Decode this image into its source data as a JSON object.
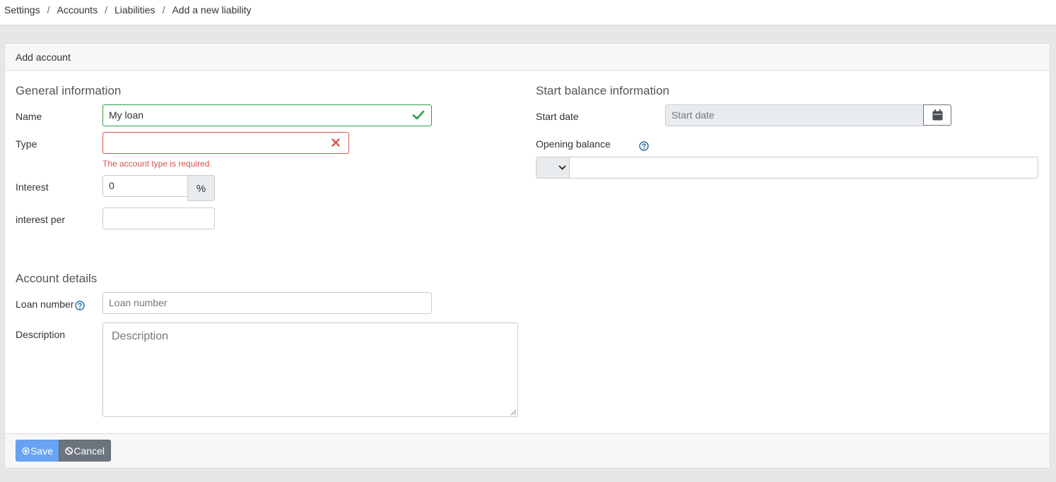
{
  "breadcrumb": {
    "items": [
      "Settings",
      "Accounts",
      "Liabilities",
      "Add a new liability"
    ],
    "separator": "/"
  },
  "card": {
    "title": "Add account"
  },
  "general": {
    "section_title": "General information",
    "name": {
      "label": "Name",
      "value": "My loan",
      "state": "valid"
    },
    "type": {
      "label": "Type",
      "value": "",
      "state": "invalid",
      "error": "The account type is required."
    },
    "interest": {
      "label": "Interest",
      "value": "0",
      "suffix": "%"
    },
    "interest_per": {
      "label": "interest per",
      "value": ""
    }
  },
  "start_balance": {
    "section_title": "Start balance information",
    "start_date": {
      "label": "Start date",
      "placeholder": "Start date"
    },
    "opening_balance": {
      "label": "Opening balance",
      "currency": "",
      "value": ""
    }
  },
  "details": {
    "section_title": "Account details",
    "loan_number": {
      "label": "Loan number",
      "placeholder": "Loan number"
    },
    "description": {
      "label": "Description",
      "placeholder": "Description"
    }
  },
  "footer": {
    "save_label": "Save",
    "cancel_label": "Cancel"
  },
  "colors": {
    "valid": "#2e9e44",
    "invalid": "#d9534f",
    "primary": "#67a3f2",
    "secondary": "#6c757d",
    "help": "#1f6f9f"
  }
}
